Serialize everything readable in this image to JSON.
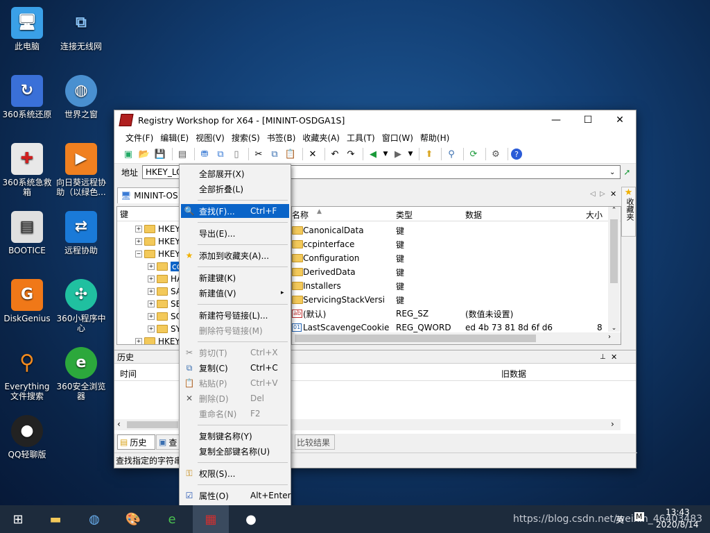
{
  "desktop": {
    "icons": [
      {
        "label": "此电脑"
      },
      {
        "label": "连接无线网"
      },
      {
        "label": "360系统还原"
      },
      {
        "label": "世界之窗"
      },
      {
        "label": "360系统急救箱"
      },
      {
        "label": "向日葵远程协助（以绿色..."
      },
      {
        "label": "BOOTICE"
      },
      {
        "label": "远程协助"
      },
      {
        "label": "DiskGenius"
      },
      {
        "label": "360小程序中心"
      },
      {
        "label": "Everything文件搜索"
      },
      {
        "label": "360安全浏览器"
      },
      {
        "label": "QQ轻聊版"
      }
    ]
  },
  "window": {
    "title": "Registry Workshop for X64 - [MININT-OSDGA1S]",
    "menu": [
      "文件(F)",
      "编辑(E)",
      "视图(V)",
      "搜索(S)",
      "书签(B)",
      "收藏夹(A)",
      "工具(T)",
      "窗口(W)",
      "帮助(H)"
    ],
    "address_label": "地址",
    "address_value": "HKEY_LO",
    "tab_label": "MININT-OS",
    "tree_header": "键",
    "tree": [
      "HKEY",
      "HKEY",
      "HKEY",
      "cc",
      "HA",
      "SA",
      "SE",
      "SO",
      "SY",
      "HKEY"
    ],
    "favorites_label": "收藏夹",
    "list_headers": {
      "name": "名称",
      "type": "类型",
      "data": "数据",
      "size": "大小"
    },
    "list_rows": [
      {
        "name": "CanonicalData",
        "type": "键",
        "data": "",
        "size": ""
      },
      {
        "name": "ccpinterface",
        "type": "键",
        "data": "",
        "size": ""
      },
      {
        "name": "Configuration",
        "type": "键",
        "data": "",
        "size": ""
      },
      {
        "name": "DerivedData",
        "type": "键",
        "data": "",
        "size": ""
      },
      {
        "name": "Installers",
        "type": "键",
        "data": "",
        "size": ""
      },
      {
        "name": "ServicingStackVersi",
        "type": "键",
        "data": "",
        "size": ""
      },
      {
        "name": "(默认)",
        "type": "REG_SZ",
        "data": "(数值未设置)",
        "size": ""
      },
      {
        "name": "LastScavengeCookie",
        "type": "REG_QWORD",
        "data": "ed 4b 73 81 8d 6f d6",
        "size": "8"
      }
    ],
    "history": {
      "title": "历史",
      "col_time": "时间",
      "col_old": "旧数据",
      "tab_history": "历史",
      "tab_search": "查",
      "tab_compare": "比较结果"
    },
    "status_text": "查找指定的字符串"
  },
  "context_menu": {
    "items": [
      {
        "label": "全部展开(X)",
        "shortcut": ""
      },
      {
        "label": "全部折叠(L)",
        "shortcut": ""
      },
      {
        "label": "查找(F)...",
        "shortcut": "Ctrl+F"
      },
      {
        "label": "导出(E)...",
        "shortcut": ""
      },
      {
        "label": "添加到收藏夹(A)...",
        "shortcut": ""
      },
      {
        "label": "新建键(K)",
        "shortcut": ""
      },
      {
        "label": "新建值(V)",
        "shortcut": "▸"
      },
      {
        "label": "新建符号链接(L)...",
        "shortcut": ""
      },
      {
        "label": "删除符号链接(M)",
        "shortcut": ""
      },
      {
        "label": "剪切(T)",
        "shortcut": "Ctrl+X"
      },
      {
        "label": "复制(C)",
        "shortcut": "Ctrl+C"
      },
      {
        "label": "粘贴(P)",
        "shortcut": "Ctrl+V"
      },
      {
        "label": "删除(D)",
        "shortcut": "Del"
      },
      {
        "label": "重命名(N)",
        "shortcut": "F2"
      },
      {
        "label": "复制键名称(Y)",
        "shortcut": ""
      },
      {
        "label": "复制全部键名称(U)",
        "shortcut": ""
      },
      {
        "label": "权限(S)...",
        "shortcut": ""
      },
      {
        "label": "属性(O)",
        "shortcut": "Alt+Enter"
      }
    ]
  },
  "taskbar": {
    "watermark": "https://blog.csdn.net/weixin_46403483",
    "time": "13:43",
    "date": "2020/8/14",
    "ime": "英",
    "ime_box": "M"
  },
  "colors": {
    "highlight": "#0a64c8",
    "taskbar": "#1d2b3c"
  }
}
